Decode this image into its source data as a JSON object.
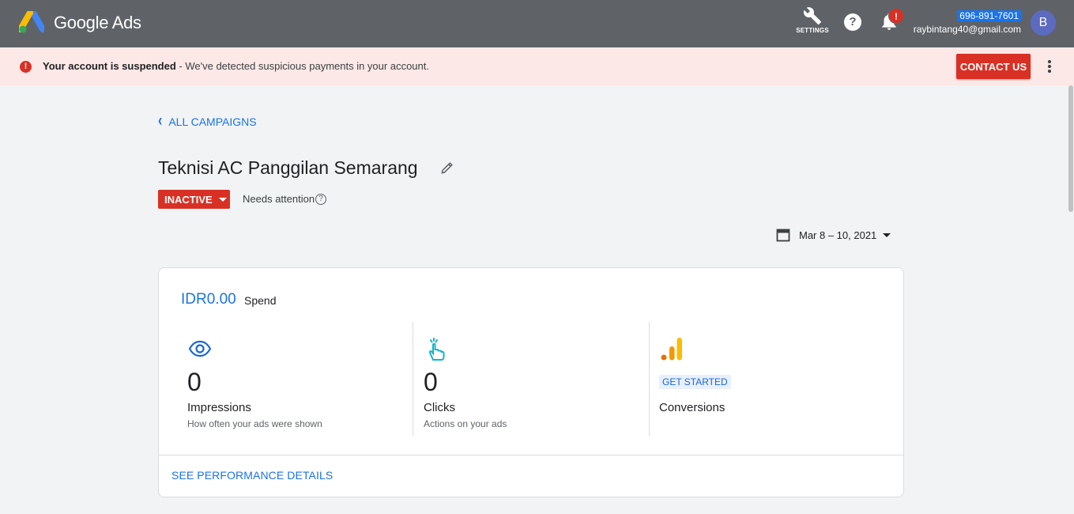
{
  "header": {
    "brand": "Google Ads",
    "settings_label": "SETTINGS",
    "help_symbol": "?",
    "notification_badge": "!",
    "account_id": "696-891-7601",
    "account_email": "raybintang40@gmail.com",
    "avatar_initial": "B",
    "colors": {
      "bar": "#5f6368",
      "account_highlight": "#1a73e8",
      "avatar": "#5c6bc0"
    }
  },
  "alert": {
    "icon_symbol": "!",
    "title": "Your account is suspended",
    "message": " - We've detected suspicious payments in your account.",
    "contact_label": "CONTACT US",
    "colors": {
      "background": "#fce8e6",
      "accent": "#d93025"
    }
  },
  "campaign": {
    "back_label": "ALL CAMPAIGNS",
    "title": "Teknisi AC Panggilan Semarang",
    "status": "INACTIVE",
    "status_note": "Needs attention",
    "help_symbol": "?",
    "date_range": "Mar 8 – 10, 2021"
  },
  "summary": {
    "spend_value": "IDR0.00",
    "spend_label": "Spend",
    "metrics": [
      {
        "icon": "eye-icon",
        "value": "0",
        "name": "Impressions",
        "description": "How often your ads were shown"
      },
      {
        "icon": "tap-hand-icon",
        "value": "0",
        "name": "Clicks",
        "description": "Actions on your ads"
      },
      {
        "icon": "conversion-bars-icon",
        "action": "GET STARTED",
        "name": "Conversions"
      }
    ],
    "details_link": "SEE PERFORMANCE DETAILS"
  }
}
